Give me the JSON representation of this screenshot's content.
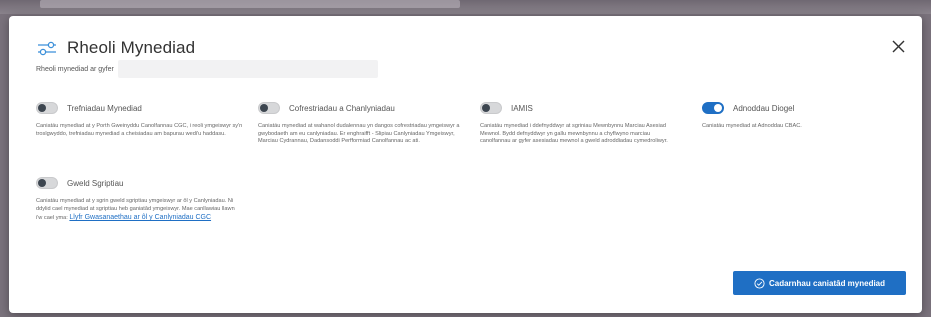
{
  "modal": {
    "title": "Rheoli Mynediad",
    "subtitle": "Rheoli mynediad ar gyfer",
    "subtitle_value": ""
  },
  "permissions": [
    {
      "label": "Trefniadau Mynediad",
      "enabled": false,
      "description": "Caniatáu mynediad at y Porth Gweinyddu Canolfannau CGC, i reoli ymgeiswyr sy'n troslgwyddo, trefniadau mynediad a cheisiadau am bapurau wedi'u haddasu."
    },
    {
      "label": "Cofrestriadau a Chanlyniadau",
      "enabled": false,
      "description": "Caniatáu mynediad at wahanol dudalennau yn dangos cofrestriadau ymgeiswyr a gwybodaeth am eu canlyniadau. Er enghraifft - Slipiau Canlyniadau Ymgeiswyr, Marciau Cydrannau, Dadansoddi Perfformiad Canolfannau ac ati."
    },
    {
      "label": "IAMIS",
      "enabled": false,
      "description": "Caniatáu mynediad i ddefnyddwyr at sgriniau Mewnbynnu Marciau Asesiad Mewnol. Bydd defnyddwyr yn gallu mewnbynnu a chyflwyno marciau canolfannau ar gyfer asesiadau mewnol a gweld adroddiadau cymedroliwyr."
    },
    {
      "label": "Adnoddau Diogel",
      "enabled": true,
      "description": "Caniatáu mynediad at Adnoddau CBAC."
    },
    {
      "label": "Gweld Sgriptiau",
      "enabled": false,
      "description": "Caniatáu mynediad at y sgrin gweld sgriptiau ymgeiswyr ar ôl y Canlyniadau. Ni ddylid cael mynediad at sgriptiau heb ganiatâd ymgeiswyr. Mae canllawiau llawn i'w cael yma:",
      "link": "Llyfr Gwasanaethau ar ôl y Canlyniadau CGC"
    }
  ],
  "actions": {
    "confirm_label": "Cadarnhau caniatâd mynediad"
  },
  "icons": {
    "title": "sliders-icon",
    "close": "close-icon",
    "confirm": "check-circle-icon"
  },
  "colors": {
    "accent": "#1f6fc4",
    "toggle_off": "#d7d8da",
    "knob_off": "#3d4650"
  }
}
